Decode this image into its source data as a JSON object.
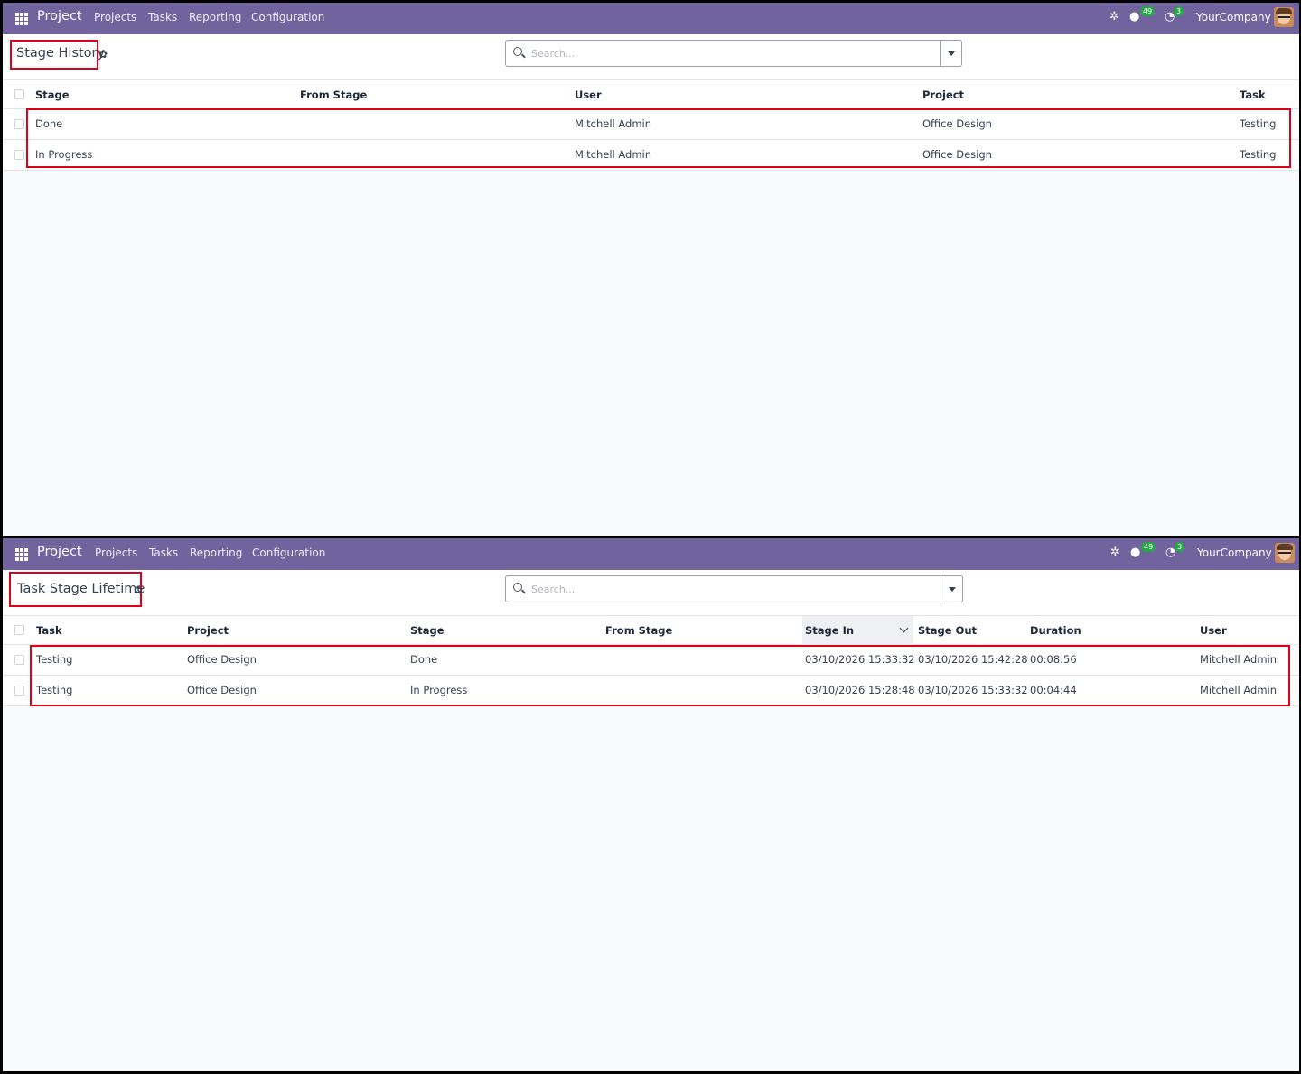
{
  "nav": {
    "brand": "Project",
    "menu": [
      "Projects",
      "Tasks",
      "Reporting",
      "Configuration"
    ],
    "messages_count": "49",
    "activities_count": "3",
    "company": "YourCompany"
  },
  "stage_history": {
    "title": "Stage History",
    "search_placeholder": "Search...",
    "columns": [
      "Stage",
      "From Stage",
      "User",
      "Project",
      "Task"
    ],
    "rows": [
      {
        "stage": "Done",
        "from_stage": "",
        "user": "Mitchell Admin",
        "project": "Office Design",
        "task": "Testing"
      },
      {
        "stage": "In Progress",
        "from_stage": "",
        "user": "Mitchell Admin",
        "project": "Office Design",
        "task": "Testing"
      }
    ]
  },
  "task_stage_lifetime": {
    "title": "Task Stage Lifetime",
    "search_placeholder": "Search...",
    "columns": [
      "Task",
      "Project",
      "Stage",
      "From Stage",
      "Stage In",
      "Stage Out",
      "Duration",
      "User"
    ],
    "sorted_column": "Stage In",
    "rows": [
      {
        "task": "Testing",
        "project": "Office Design",
        "stage": "Done",
        "from_stage": "",
        "stage_in": "03/10/2026 15:33:32",
        "stage_out": "03/10/2026 15:42:28",
        "duration": "00:08:56",
        "user": "Mitchell Admin"
      },
      {
        "task": "Testing",
        "project": "Office Design",
        "stage": "In Progress",
        "from_stage": "",
        "stage_in": "03/10/2026 15:28:48",
        "stage_out": "03/10/2026 15:33:32",
        "duration": "00:04:44",
        "user": "Mitchell Admin"
      }
    ]
  }
}
